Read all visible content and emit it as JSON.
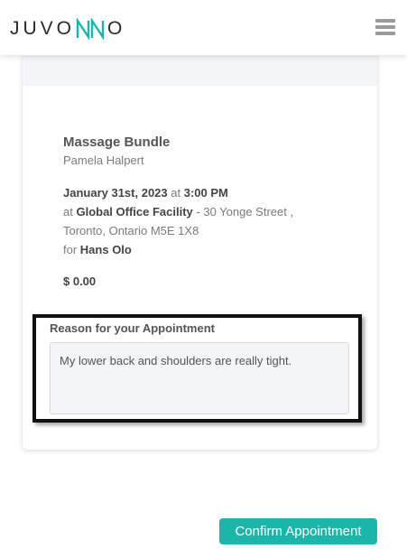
{
  "header": {
    "logo_before": "JUVO",
    "logo_after": "O",
    "menu_icon": "hamburger-menu-icon"
  },
  "appointment": {
    "service": "Massage Bundle",
    "provider": "Pamela Halpert",
    "date": "January 31st, 2023",
    "at_word": "at",
    "time": "3:00 PM",
    "at_word_2": "at",
    "location": "Global Office Facility",
    "address_1": " - 30 Yonge Street ,",
    "address_2": "Toronto, Ontario M5E 1X8",
    "for_word": "for",
    "client": "Hans Olo",
    "price": "$ 0.00"
  },
  "reason": {
    "label": "Reason for your Appointment",
    "value": "My lower back and shoulders are really tight."
  },
  "actions": {
    "confirm_label": "Confirm Appointment"
  },
  "colors": {
    "accent": "#1cb5aa",
    "logo_nn": "#1cb5aa"
  }
}
